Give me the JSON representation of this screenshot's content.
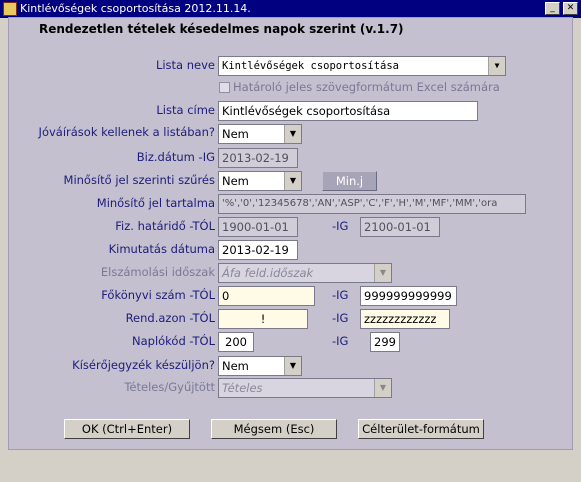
{
  "window": {
    "title": "Kintlévőségek csoportosítása 2012.11.14."
  },
  "form": {
    "heading": "Rendezetlen tételek késedelmes napok szerint (v.1.7)",
    "lista_neve": {
      "label": "Lista neve",
      "value": "Kintlévőségek csoportosítása"
    },
    "hatarolo": {
      "label": "Határoló jeles szövegformátum  Excel számára",
      "checked": false
    },
    "lista_cime": {
      "label": "Lista címe",
      "value": "Kintlévőségek csoportosítása"
    },
    "jovairasok": {
      "label": "Jóváírások kellenek a listában?",
      "value": "Nem"
    },
    "biz_datum": {
      "label": "Biz.dátum -IG",
      "value": "2013-02-19"
    },
    "minosito_szures": {
      "label": "Minősítő jel szerinti szűrés",
      "value": "Nem",
      "button": "Min.j"
    },
    "minosito_tartalma": {
      "label": "Minősítő jel tartalma",
      "value": "'%','0','12345678','AN','ASP','C','F','H','M','MF','MM','ora"
    },
    "fiz_hatarido": {
      "label": "Fiz. határidő -TÓL",
      "from": "1900-01-01",
      "to_label": "-IG",
      "to": "2100-01-01"
    },
    "kimutatas_datuma": {
      "label": "Kimutatás dátuma",
      "value": "2013-02-19"
    },
    "elszamolasi": {
      "label": "Elszámolási időszak",
      "value": "Áfa feld.időszak"
    },
    "fokonyvi": {
      "label": "Főkönyvi szám -TÓL",
      "from": "0",
      "to_label": "-IG",
      "to": "999999999999"
    },
    "rend_azon": {
      "label": "Rend.azon -TÓL",
      "from": "!",
      "to_label": "-IG",
      "to": "zzzzzzzzzzzz"
    },
    "naplokod": {
      "label": "Naplókód -TÓL",
      "from": "200",
      "to_label": "-IG",
      "to": "299"
    },
    "kiserojegyzek": {
      "label": "Kísérőjegyzék készüljön?",
      "value": "Nem"
    },
    "teteles": {
      "label": "Tételes/Gyűjtött",
      "value": "Tételes"
    }
  },
  "buttons": {
    "ok": "OK (Ctrl+Enter)",
    "cancel": "Mégsem (Esc)",
    "target": "Célterület-formátum"
  },
  "colors": {
    "titlebar": "#000080",
    "label": "#1c1c7a",
    "panel": "#c4c0d0",
    "highlight": "#fffbe6"
  }
}
